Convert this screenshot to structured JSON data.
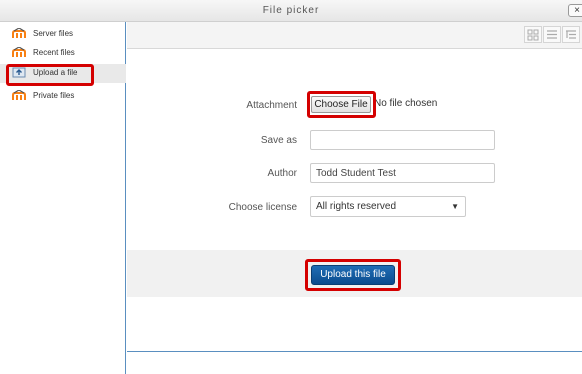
{
  "window": {
    "title": "File picker",
    "close_label": "×"
  },
  "sidebar": {
    "items": [
      {
        "label": "Server files",
        "icon": "moodle-logo-icon",
        "active": false
      },
      {
        "label": "Recent files",
        "icon": "moodle-logo-icon",
        "active": false
      },
      {
        "label": "Upload a file",
        "icon": "upload-icon",
        "active": true
      },
      {
        "label": "Private files",
        "icon": "moodle-logo-icon",
        "active": false
      }
    ]
  },
  "toolbar": {
    "view_buttons": [
      "icons-view-icon",
      "list-view-icon",
      "tree-view-icon"
    ]
  },
  "form": {
    "attachment_label": "Attachment",
    "choose_file_label": "Choose File",
    "no_file_text": "No file chosen",
    "save_as_label": "Save as",
    "save_as_value": "",
    "author_label": "Author",
    "author_value": "Todd Student Test",
    "license_label": "Choose license",
    "license_value": "All rights reserved"
  },
  "actions": {
    "upload_label": "Upload this file"
  },
  "colors": {
    "highlight": "#d40000",
    "primary_button": "#0b4c8e",
    "border_accent": "#5a8fc0",
    "moodle_orange": "#f98012"
  }
}
